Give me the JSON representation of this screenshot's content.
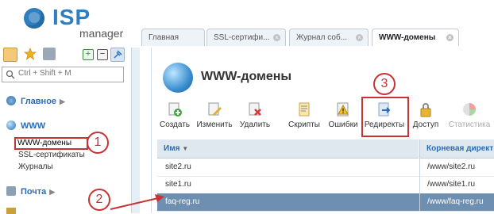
{
  "brand": {
    "name": "ISP",
    "subtitle": "manager",
    "color": "#2f7fbf"
  },
  "search": {
    "placeholder": "Ctrl + Shift + M"
  },
  "sidebar": {
    "sections": [
      {
        "label": "Главное",
        "icon": "gear-icon",
        "items": []
      },
      {
        "label": "WWW",
        "icon": "globe-icon",
        "items": [
          "WWW-домены",
          "SSL-сертификаты",
          "Журналы"
        ]
      },
      {
        "label": "Почта",
        "icon": "mail-icon",
        "items": []
      }
    ],
    "active_item": "WWW-домены"
  },
  "tabs": [
    {
      "label": "Главная"
    },
    {
      "label": "SSL-сертифи..."
    },
    {
      "label": "Журнал соб..."
    },
    {
      "label": "WWW-домены",
      "active": true
    }
  ],
  "page": {
    "title": "WWW-домены"
  },
  "actions": [
    {
      "label": "Создать",
      "icon": "add-icon"
    },
    {
      "label": "Изменить",
      "icon": "edit-icon"
    },
    {
      "label": "Удалить",
      "icon": "delete-icon"
    },
    {
      "label": "Скрипты",
      "icon": "script-icon"
    },
    {
      "label": "Ошибки",
      "icon": "warning-icon"
    },
    {
      "label": "Редиректы",
      "icon": "redirect-icon"
    },
    {
      "label": "Доступ",
      "icon": "lock-icon"
    },
    {
      "label": "Статистика",
      "icon": "chart-icon",
      "disabled": true
    }
  ],
  "table": {
    "columns": [
      "Имя",
      "Корневая директ"
    ],
    "rows": [
      {
        "name": "site2.ru",
        "root": "/www/site2.ru"
      },
      {
        "name": "site1.ru",
        "root": "/www/site1.ru"
      },
      {
        "name": "faq-reg.ru",
        "root": "/www/faq-reg.ru",
        "selected": true
      }
    ]
  },
  "callouts": [
    "1",
    "2",
    "3"
  ],
  "colors": {
    "highlight": "#c73333",
    "selected_row": "#6f8fb0",
    "header_bg": "#dfe7ef",
    "link": "#2a6cb5"
  }
}
